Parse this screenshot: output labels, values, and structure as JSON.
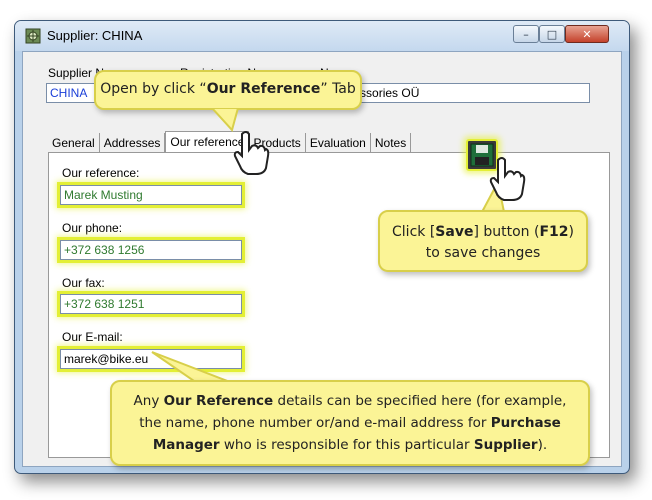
{
  "window": {
    "title": "Supplier: CHINA",
    "controls": {
      "minimize": "–",
      "maximize": "□",
      "close": "✕"
    }
  },
  "header": {
    "supplier_label": "Supplier N",
    "registration_label": "Registration N",
    "name_label": "N",
    "supplier_value": "CHINA",
    "name_value": "e Accessories OÜ"
  },
  "tabs": [
    "General",
    "Addresses",
    "Our reference",
    "Products",
    "Evaluation",
    "Notes"
  ],
  "form": {
    "reference_label": "Our reference:",
    "reference_value": "Marek Musting",
    "phone_label": "Our phone:",
    "phone_value": "+372 638 1256",
    "fax_label": "Our fax:",
    "fax_value": "+372 638 1251",
    "email_label": "Our E-mail:",
    "email_value": "marek@bike.eu"
  },
  "callouts": {
    "open_prefix": "Open by click “",
    "open_bold": "Our Reference",
    "open_suffix": "” Tab",
    "save_prefix": "Click [",
    "save_bold": "Save",
    "save_mid": "] button (",
    "save_key": "F12",
    "save_suffix": ")",
    "save_line2": "to save changes",
    "info_p1": "Any ",
    "info_b1": "Our Reference",
    "info_p2": " details can be specified here (for example, the name, phone number or/and e-mail address for ",
    "info_b2": "Purchase Manager",
    "info_p3": " who is responsible for this particular ",
    "info_b3": "Supplier",
    "info_p4": ")."
  },
  "colors": {
    "highlight": "#e3ef35",
    "callout_fill": "#fbf496",
    "input_text_green": "#2f7a2f"
  },
  "icons": [
    "supplier-app-icon",
    "save-floppy-icon",
    "pointer-hand-icon"
  ]
}
